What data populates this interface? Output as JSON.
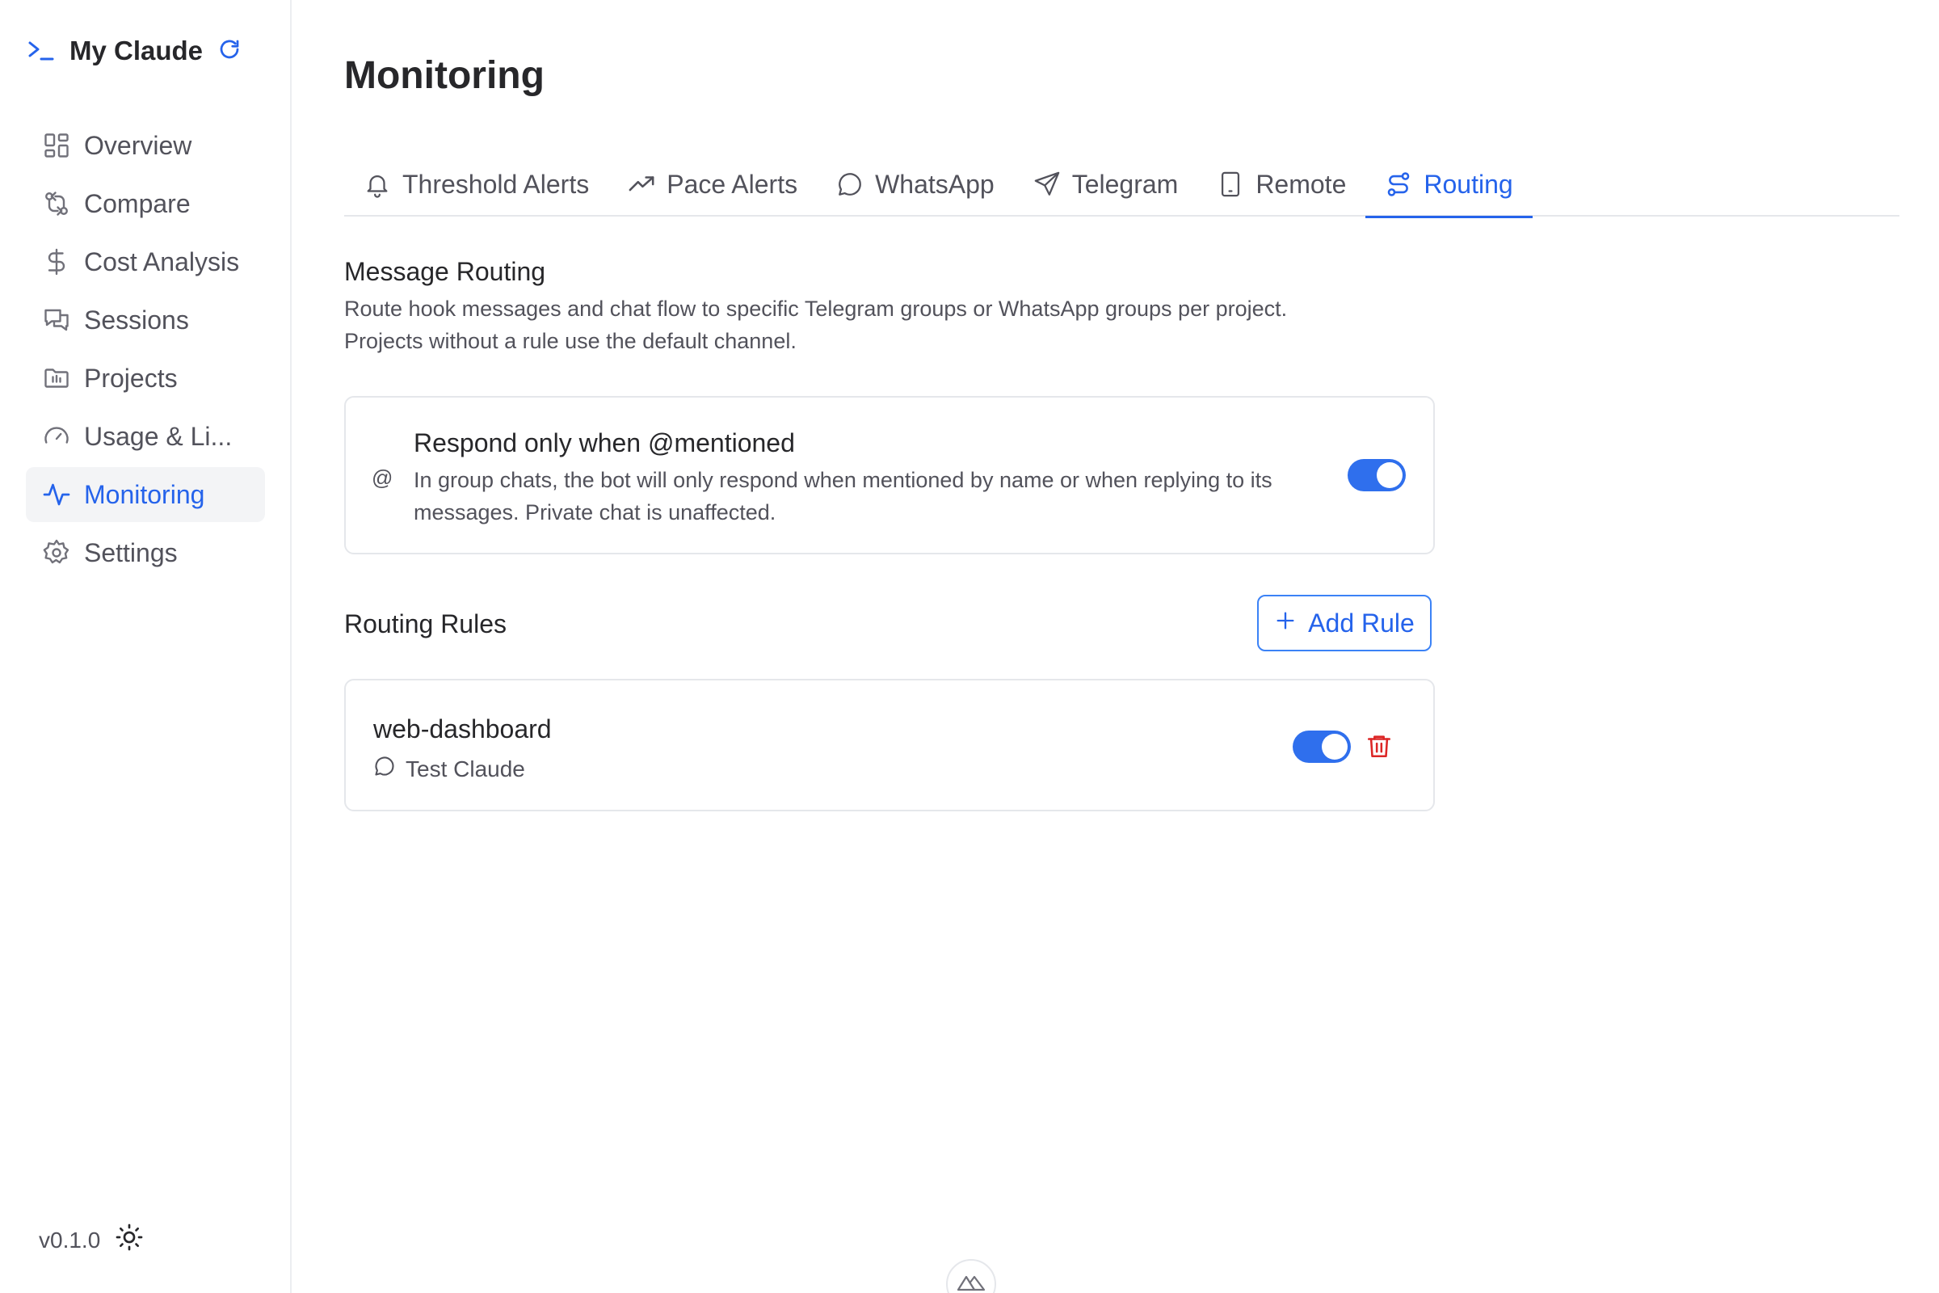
{
  "app": {
    "title": "My Claude",
    "version": "v0.1.0"
  },
  "sidebar": {
    "items": [
      {
        "label": "Overview",
        "icon": "grid-icon"
      },
      {
        "label": "Compare",
        "icon": "git-compare-icon"
      },
      {
        "label": "Cost Analysis",
        "icon": "dollar-icon"
      },
      {
        "label": "Sessions",
        "icon": "chat-bubbles-icon"
      },
      {
        "label": "Projects",
        "icon": "folder-chart-icon"
      },
      {
        "label": "Usage & Li...",
        "icon": "gauge-icon"
      },
      {
        "label": "Monitoring",
        "icon": "activity-icon",
        "active": true
      },
      {
        "label": "Settings",
        "icon": "gear-icon"
      }
    ]
  },
  "main": {
    "title": "Monitoring",
    "tabs": [
      {
        "label": "Threshold Alerts",
        "icon": "bell-icon"
      },
      {
        "label": "Pace Alerts",
        "icon": "trending-up-icon"
      },
      {
        "label": "WhatsApp",
        "icon": "message-circle-icon"
      },
      {
        "label": "Telegram",
        "icon": "send-icon"
      },
      {
        "label": "Remote",
        "icon": "tablet-icon"
      },
      {
        "label": "Routing",
        "icon": "route-icon",
        "active": true
      }
    ],
    "section": {
      "title": "Message Routing",
      "desc_line1": "Route hook messages and chat flow to specific Telegram groups or WhatsApp groups per project.",
      "desc_line2": "Projects without a rule use the default channel."
    },
    "mention": {
      "icon_text": "@",
      "title": "Respond only when @mentioned",
      "desc_line1": "In group chats, the bot will only respond when mentioned by name or when replying to its",
      "desc_line2": "messages. Private chat is unaffected.",
      "enabled": true
    },
    "rules": {
      "title": "Routing Rules",
      "add_label": "Add Rule",
      "items": [
        {
          "name": "web-dashboard",
          "target": "Test Claude",
          "enabled": true
        }
      ]
    }
  },
  "colors": {
    "accent": "#2563eb",
    "toggle": "#2f6fed",
    "danger": "#dc2626"
  }
}
